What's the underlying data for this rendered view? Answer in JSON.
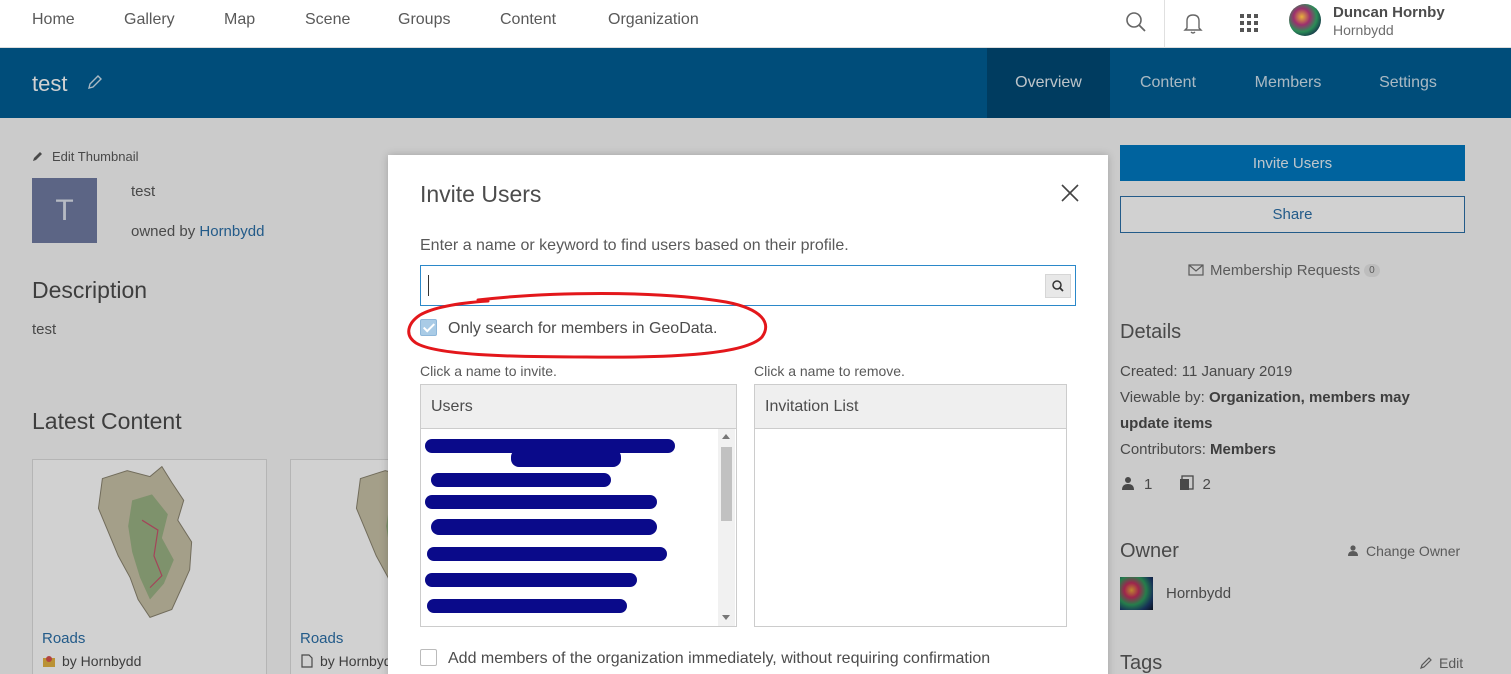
{
  "topnav": {
    "links": [
      "Home",
      "Gallery",
      "Map",
      "Scene",
      "Groups",
      "Content",
      "Organization"
    ],
    "user_name": "Duncan Hornby",
    "user_handle": "Hornbydd"
  },
  "group": {
    "title": "test",
    "tabs": [
      "Overview",
      "Content",
      "Members",
      "Settings"
    ],
    "active_tab": "Overview",
    "edit_thumbnail": "Edit Thumbnail",
    "thumb_letter": "T",
    "name": "test",
    "owned_by_prefix": "owned by",
    "owner_link": "Hornbydd",
    "description_heading": "Description",
    "description": "test",
    "latest_heading": "Latest Content",
    "cards": [
      {
        "title": "Roads",
        "by": "by Hornbydd"
      },
      {
        "title": "Roads",
        "by": "by Hornbydd"
      }
    ]
  },
  "sidebar": {
    "invite_label": "Invite Users",
    "share_label": "Share",
    "membership_label": "Membership Requests",
    "membership_count": "0",
    "details_heading": "Details",
    "created_label": "Created:",
    "created_value": "11 January 2019",
    "viewable_label": "Viewable by:",
    "viewable_value_1": "Organization, members may",
    "viewable_value_2": "update items",
    "contributors_label": "Contributors:",
    "contributors_value": "Members",
    "member_count": "1",
    "item_count": "2",
    "owner_heading": "Owner",
    "change_owner": "Change Owner",
    "owner_name": "Hornbydd",
    "tags_heading": "Tags",
    "tags_edit": "Edit"
  },
  "modal": {
    "title": "Invite Users",
    "instructions": "Enter a name or keyword to find users based on their profile.",
    "search_value": "",
    "only_members_label": "Only search for members in GeoData.",
    "only_members_checked": true,
    "hint_invite": "Click a name to invite.",
    "hint_remove": "Click a name to remove.",
    "users_header": "Users",
    "invitation_header": "Invitation List",
    "add_immediately_label": "Add members of the organization immediately, without requiring confirmation",
    "highlight_color": "#e3171b",
    "redaction_color": "#0a0a8a"
  }
}
